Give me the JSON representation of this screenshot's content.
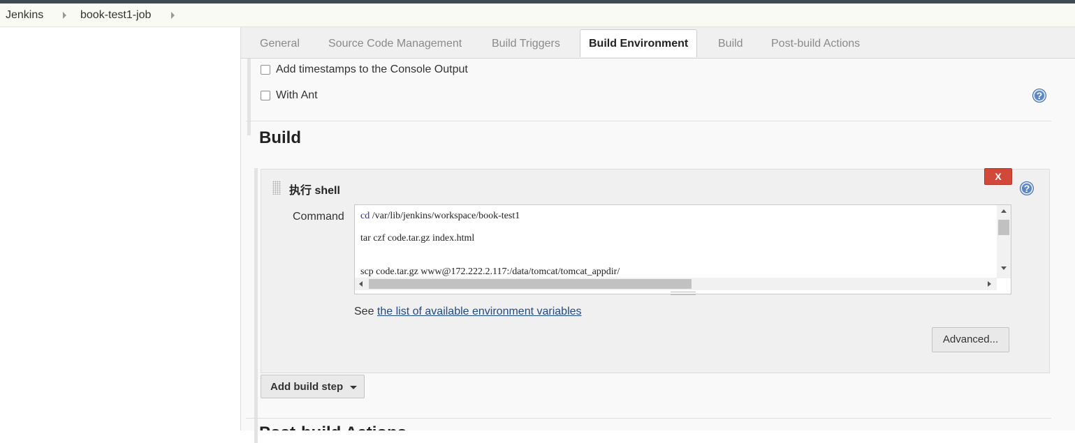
{
  "breadcrumb": {
    "items": [
      "Jenkins",
      "book-test1-job"
    ]
  },
  "tabs": [
    {
      "label": "General",
      "active": false
    },
    {
      "label": "Source Code Management",
      "active": false
    },
    {
      "label": "Build Triggers",
      "active": false
    },
    {
      "label": "Build Environment",
      "active": true
    },
    {
      "label": "Build",
      "active": false
    },
    {
      "label": "Post-build Actions",
      "active": false
    }
  ],
  "build_environment": {
    "options": [
      {
        "label": "Add timestamps to the Console Output",
        "checked": false
      },
      {
        "label": "With Ant",
        "checked": false
      }
    ]
  },
  "build": {
    "section_title": "Build",
    "step": {
      "title": "执行 shell",
      "delete_label": "X",
      "command_label": "Command",
      "command_lines": [
        "cd /var/lib/jenkins/workspace/book-test1",
        "tar czf code.tar.gz index.html",
        "",
        "scp code.tar.gz www@172.222.2.117:/data/tomcat/tomcat_appdir/"
      ],
      "env_note_prefix": "See",
      "env_link": "the list of available environment variables",
      "advanced_label": "Advanced..."
    },
    "add_step_label": "Add build step"
  },
  "post_build": {
    "section_title": "Post-build Actions"
  },
  "icons": {
    "help": "help-icon",
    "dropdown": "caret-down-icon",
    "drag": "drag-handle-icon"
  },
  "colors": {
    "delete_button": "#d24939",
    "link": "#204a87",
    "help_icon": "#5b87c7",
    "keyword_cd": "#2a2a9a"
  }
}
